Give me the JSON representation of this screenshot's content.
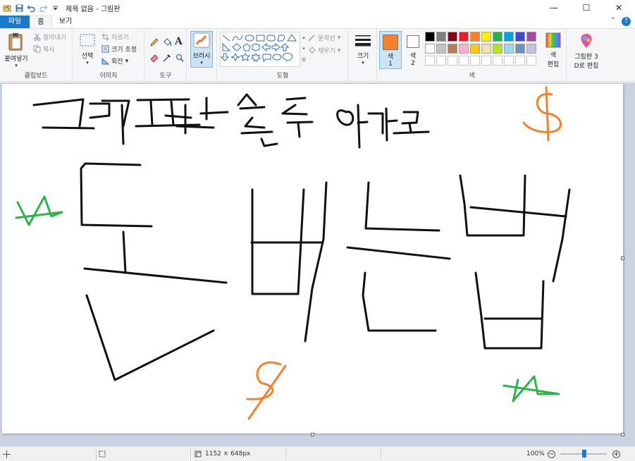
{
  "window": {
    "title": "제목 없음 - 그림판",
    "controls": {
      "minimize": "—",
      "maximize": "☐",
      "close": "✕"
    }
  },
  "tabs": {
    "file": "파일",
    "home": "홈",
    "view": "보기"
  },
  "tabs_right": {
    "collapse": "⌃",
    "help": "?"
  },
  "ribbon": {
    "clipboard": {
      "paste": "붙여넣기",
      "cut": "잘라내기",
      "copy": "복사",
      "label": "클립보드"
    },
    "image": {
      "select": "선택",
      "crop": "자르기",
      "resize": "크기 조정",
      "rotate": "회전",
      "label": "이미지"
    },
    "tools": {
      "label": "도구",
      "text_glyph": "A"
    },
    "brushes": {
      "label": "브러시"
    },
    "shapes": {
      "outline": "윤곽선",
      "fill": "채우기",
      "label": "도형"
    },
    "size": {
      "label": "크기"
    },
    "colors": {
      "color1": "색\n1",
      "color1_line1": "색",
      "color1_line2": "1",
      "color2_line1": "색",
      "color2_line2": "2",
      "edit_line1": "색",
      "edit_line2": "편집",
      "label": "색",
      "color1_value": "#f7802a",
      "color2_value": "#ffffff",
      "palette_row1": [
        "#000000",
        "#7f7f7f",
        "#880015",
        "#ed1c24",
        "#ff7f27",
        "#fff200",
        "#22b14c",
        "#00a2e8",
        "#3f48cc",
        "#a349a4"
      ],
      "palette_row2": [
        "#ffffff",
        "#c3c3c3",
        "#b97a57",
        "#ffaec9",
        "#ffc90e",
        "#efe4b0",
        "#b5e61d",
        "#99d9ea",
        "#7092be",
        "#c8bfe7"
      ]
    },
    "paint3d": {
      "line1": "그림판 3",
      "line2": "D로 편집"
    }
  },
  "status": {
    "dimensions": "1152 × 648px",
    "zoom": "100%",
    "zoom_out": "−",
    "zoom_in": "+"
  },
  "drawing": {
    "ink_black": "#111111",
    "ink_orange": "#f7802a",
    "ink_green": "#2db34a"
  }
}
